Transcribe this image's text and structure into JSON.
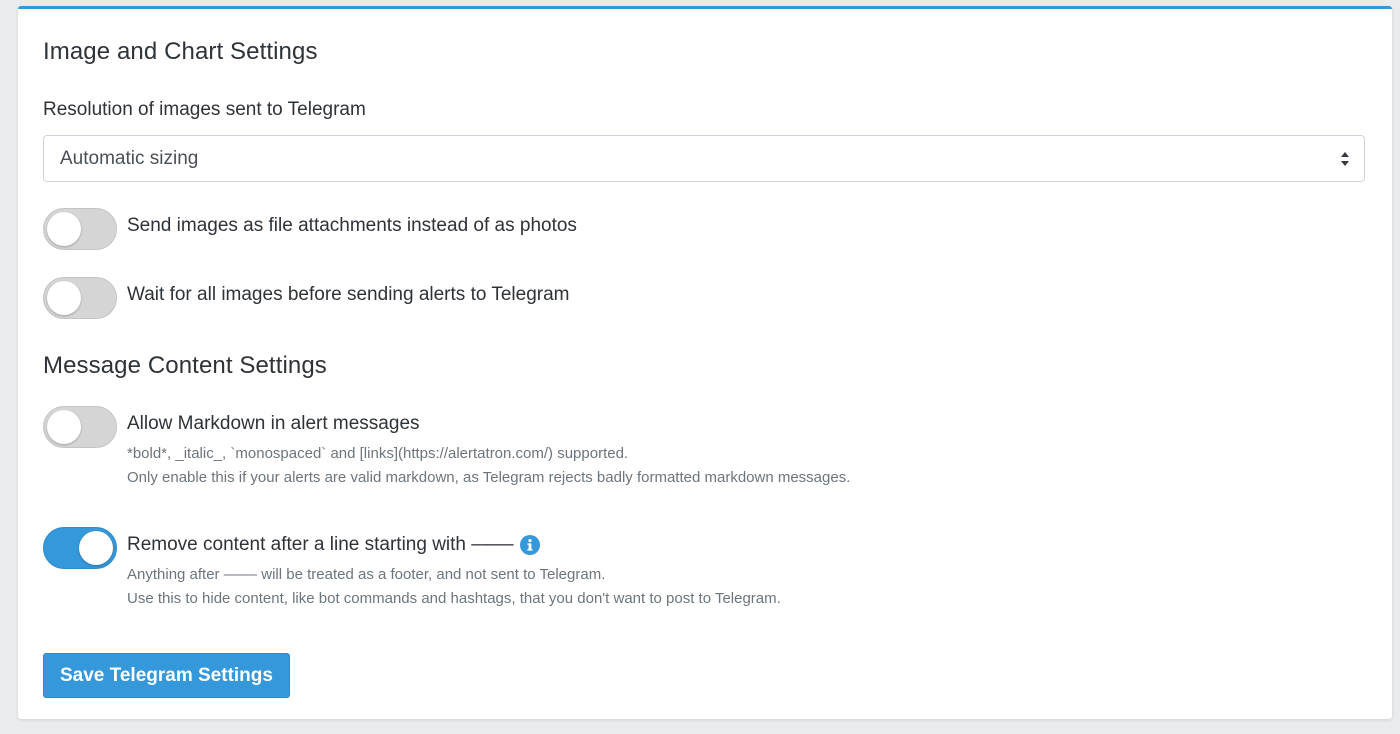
{
  "image_settings": {
    "title": "Image and Chart Settings",
    "resolution_label": "Resolution of images sent to Telegram",
    "resolution_selected": "Automatic sizing",
    "send_as_files_label": "Send images as file attachments instead of as photos",
    "send_as_files_on": false,
    "wait_images_label": "Wait for all images before sending alerts to Telegram",
    "wait_images_on": false
  },
  "message_settings": {
    "title": "Message Content Settings",
    "markdown_label": "Allow Markdown in alert messages",
    "markdown_on": false,
    "markdown_help_line1": "*bold*, _italic_, `monospaced` and [links](https://alertatron.com/) supported.",
    "markdown_help_line2": "Only enable this if your alerts are valid markdown, as Telegram rejects badly formatted markdown messages.",
    "footer_label": "Remove content after a line starting with ––––",
    "footer_on": true,
    "footer_help_line1": "Anything after –––– will be treated as a footer, and not sent to Telegram.",
    "footer_help_line2": "Use this to hide content, like bot commands and hashtags, that you don't want to post to Telegram."
  },
  "save_button_label": "Save Telegram Settings",
  "colors": {
    "accent": "#3498db",
    "toggle_off": "#d5d5d5",
    "text": "#2e3338",
    "muted": "#6c757d"
  },
  "icons": {
    "select_caret": "sort-caret-icon",
    "footer_info": "info-circle-icon"
  }
}
